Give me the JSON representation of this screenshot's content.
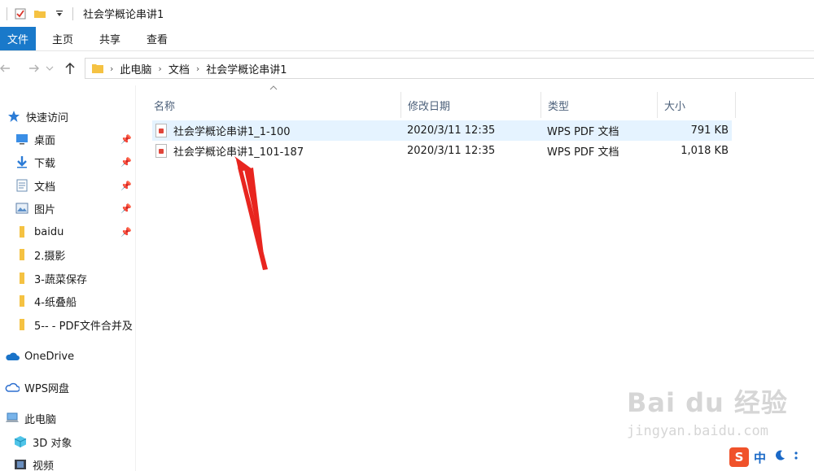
{
  "window": {
    "title": "社会学概论串讲1"
  },
  "ribbon": {
    "tabs": [
      "文件",
      "主页",
      "共享",
      "查看"
    ]
  },
  "address": {
    "crumbs": [
      "此电脑",
      "文档",
      "社会学概论串讲1"
    ]
  },
  "sidebar": {
    "quick_access": "快速访问",
    "items": [
      {
        "label": "桌面",
        "icon": "desktop-icon",
        "pinned": true
      },
      {
        "label": "下载",
        "icon": "download-icon",
        "pinned": true
      },
      {
        "label": "文档",
        "icon": "document-icon",
        "pinned": true
      },
      {
        "label": "图片",
        "icon": "picture-icon",
        "pinned": true
      },
      {
        "label": "baidu",
        "icon": "folder-icon",
        "pinned": true
      },
      {
        "label": "2.摄影",
        "icon": "folder-icon",
        "pinned": false
      },
      {
        "label": "3-蔬菜保存",
        "icon": "folder-icon",
        "pinned": false
      },
      {
        "label": "4-纸叠船",
        "icon": "folder-icon",
        "pinned": false
      },
      {
        "label": "5-- - PDF文件合并及",
        "icon": "folder-icon",
        "pinned": false
      }
    ],
    "onedrive": "OneDrive",
    "wps": "WPS网盘",
    "this_pc": "此电脑",
    "objects_3d": "3D 对象",
    "videos": "视频"
  },
  "columns": {
    "name": "名称",
    "modified": "修改日期",
    "type": "类型",
    "size": "大小"
  },
  "files": [
    {
      "name": "社会学概论串讲1_1-100",
      "modified": "2020/3/11 12:35",
      "type": "WPS PDF 文档",
      "size": "791 KB"
    },
    {
      "name": "社会学概论串讲1_101-187",
      "modified": "2020/3/11 12:35",
      "type": "WPS PDF 文档",
      "size": "1,018 KB"
    }
  ],
  "watermark": {
    "logo": "Bai du 经验",
    "url": "jingyan.baidu.com"
  },
  "ime": {
    "logo": "S",
    "mode": "中"
  },
  "colors": {
    "accent": "#1979ca",
    "selection": "#e5f3ff",
    "annotation": "#e8251f"
  }
}
